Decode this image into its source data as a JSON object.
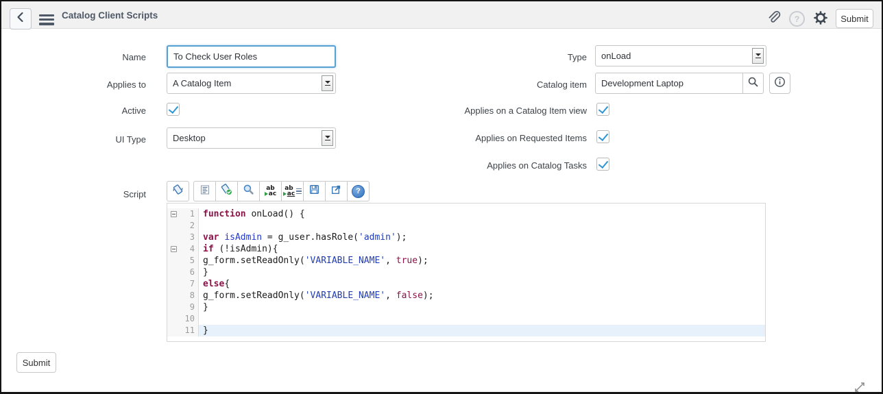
{
  "header": {
    "title": "Catalog Client Scripts",
    "submit_label": "Submit",
    "help_glyph": "?"
  },
  "fields": {
    "name": {
      "label": "Name",
      "value": "To Check User Roles"
    },
    "type": {
      "label": "Type",
      "value": "onLoad"
    },
    "applies_to": {
      "label": "Applies to",
      "value": "A Catalog Item"
    },
    "catalog_item": {
      "label": "Catalog item",
      "value": "Development Laptop"
    },
    "active": {
      "label": "Active",
      "checked": true
    },
    "applies_on_catalog_item_view": {
      "label": "Applies on a Catalog Item view",
      "checked": true
    },
    "ui_type": {
      "label": "UI Type",
      "value": "Desktop"
    },
    "applies_on_requested_items": {
      "label": "Applies on Requested Items",
      "checked": true
    },
    "applies_on_catalog_tasks": {
      "label": "Applies on Catalog Tasks",
      "checked": true
    },
    "script": {
      "label": "Script"
    }
  },
  "script_editor": {
    "toolbar": {
      "buttons": [
        "toggle-syntax-editor",
        "format-code",
        "check-syntax",
        "search-in-script",
        "replace",
        "replace-all",
        "save-script",
        "open-in-new-window",
        "help"
      ],
      "replace_glyph": {
        "top": "ab",
        "bottom": "ac"
      },
      "help_glyph": "?"
    },
    "colors": {
      "keyword": "#8b1048",
      "identifier": "#2135c8",
      "string": "#1f3bb5",
      "active_line": "#e7f1fb"
    },
    "lines": [
      {
        "num": "1",
        "fold": true,
        "tokens": [
          [
            "kw",
            "function"
          ],
          [
            "pl",
            " onLoad() {"
          ]
        ]
      },
      {
        "num": "2",
        "tokens": []
      },
      {
        "num": "3",
        "tokens": [
          [
            "kw",
            "var"
          ],
          [
            "pl",
            " "
          ],
          [
            "def",
            "isAdmin"
          ],
          [
            "pl",
            " = g_user.hasRole("
          ],
          [
            "str",
            "'admin'"
          ],
          [
            "pl",
            ");"
          ]
        ]
      },
      {
        "num": "4",
        "fold": true,
        "tokens": [
          [
            "kw",
            "if"
          ],
          [
            "pl",
            " (!isAdmin){"
          ]
        ]
      },
      {
        "num": "5",
        "tokens": [
          [
            "pl",
            "g_form.setReadOnly("
          ],
          [
            "str",
            "'VARIABLE_NAME'"
          ],
          [
            "pl",
            ", "
          ],
          [
            "atom",
            "true"
          ],
          [
            "pl",
            ");"
          ]
        ]
      },
      {
        "num": "6",
        "tokens": [
          [
            "pl",
            "}"
          ]
        ]
      },
      {
        "num": "7",
        "tokens": [
          [
            "kw",
            "else"
          ],
          [
            "pl",
            "{"
          ]
        ]
      },
      {
        "num": "8",
        "tokens": [
          [
            "pl",
            "g_form.setReadOnly("
          ],
          [
            "str",
            "'VARIABLE_NAME'"
          ],
          [
            "pl",
            ", "
          ],
          [
            "atom",
            "false"
          ],
          [
            "pl",
            ");"
          ]
        ]
      },
      {
        "num": "9",
        "tokens": [
          [
            "pl",
            "}"
          ]
        ]
      },
      {
        "num": "10",
        "tokens": []
      },
      {
        "num": "11",
        "active": true,
        "tokens": [
          [
            "pl",
            "}"
          ]
        ]
      }
    ]
  },
  "footer": {
    "submit_label": "Submit"
  }
}
